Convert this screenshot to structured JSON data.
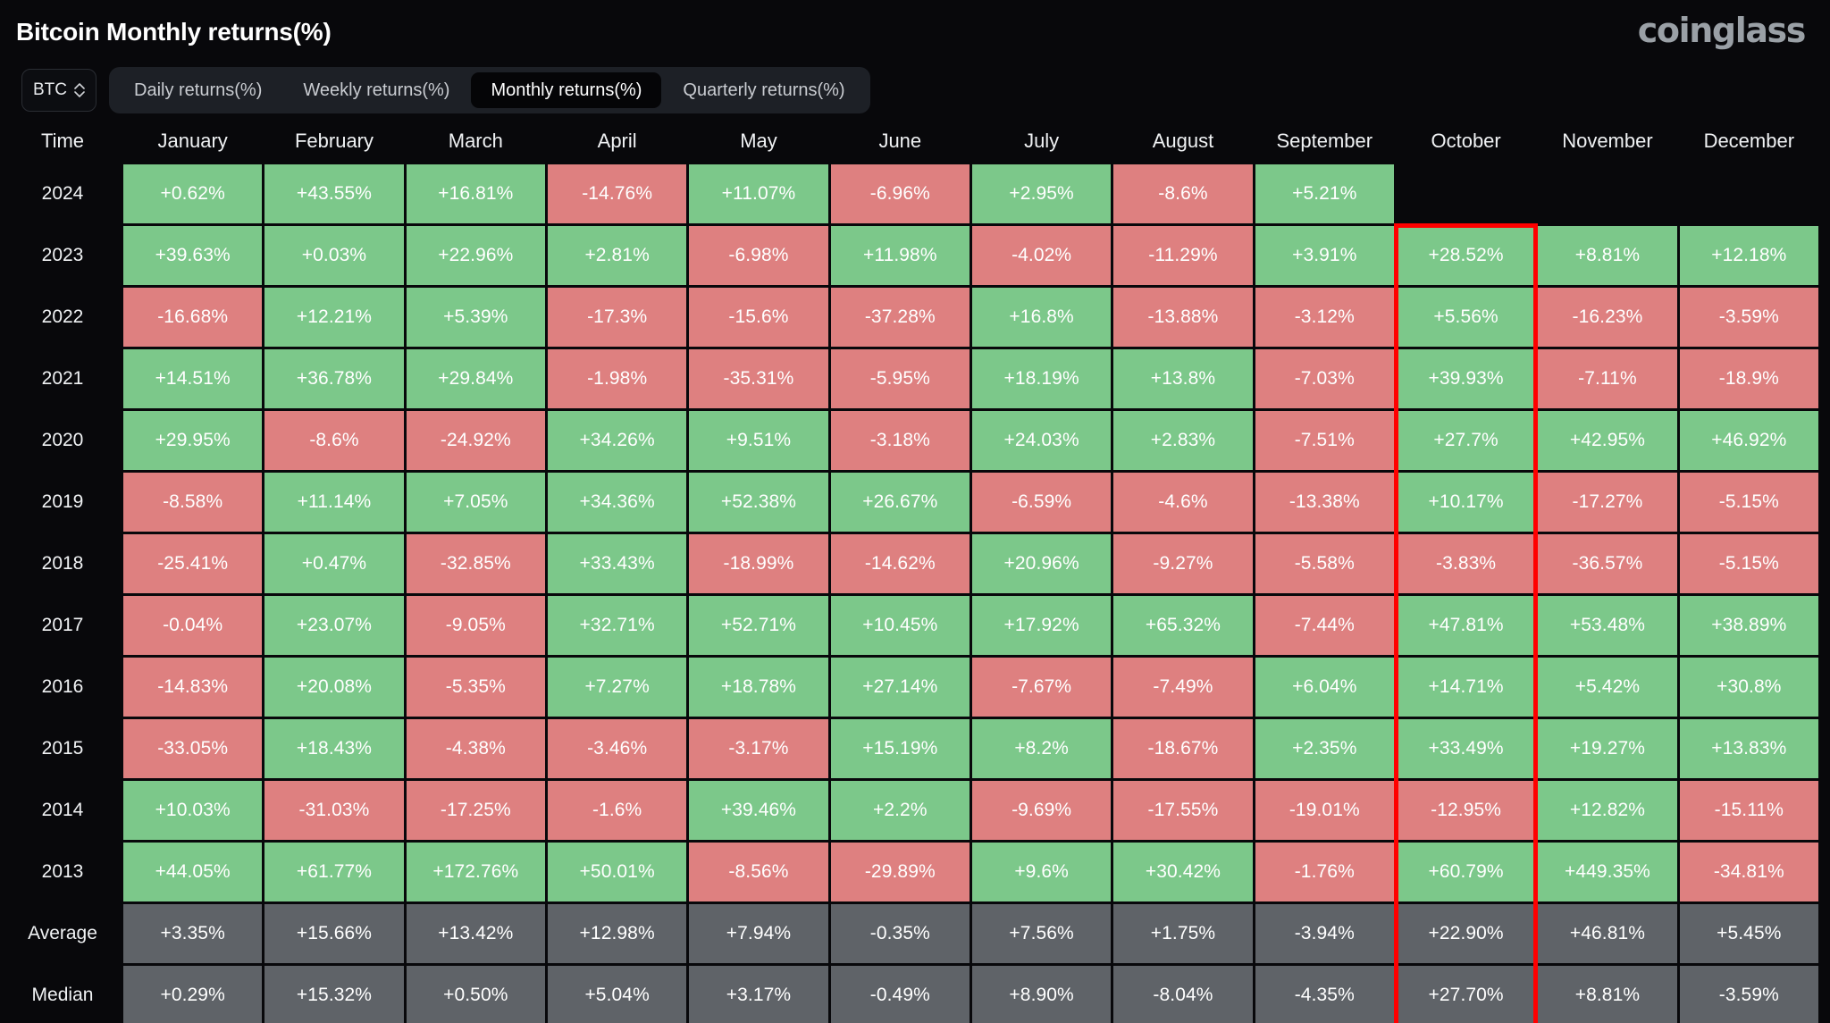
{
  "header": {
    "title": "Bitcoin Monthly returns(%)",
    "brand": "coinglass"
  },
  "controls": {
    "symbol": {
      "value": "BTC",
      "icon": "chevron-updown-icon"
    },
    "tabs": [
      {
        "label": "Daily returns(%)",
        "active": false
      },
      {
        "label": "Weekly returns(%)",
        "active": false
      },
      {
        "label": "Monthly returns(%)",
        "active": true
      },
      {
        "label": "Quarterly returns(%)",
        "active": false
      }
    ]
  },
  "highlight": {
    "color": "#ff0000",
    "column": "October",
    "from_row": "2023",
    "to_row": "Median"
  },
  "colors": {
    "positive": "#7cc88a",
    "negative": "#de8080",
    "neutral": "#5f6368",
    "background": "#08080b",
    "accent": "#ff0000"
  },
  "chart_data": {
    "type": "heatmap",
    "title": "Bitcoin Monthly returns(%)",
    "xlabel": "",
    "ylabel": "Time",
    "columns": [
      "Time",
      "January",
      "February",
      "March",
      "April",
      "May",
      "June",
      "July",
      "August",
      "September",
      "October",
      "November",
      "December"
    ],
    "rows": [
      {
        "label": "2024",
        "kind": "year",
        "values": [
          "+0.62%",
          "+43.55%",
          "+16.81%",
          "-14.76%",
          "+11.07%",
          "-6.96%",
          "+2.95%",
          "-8.6%",
          "+5.21%",
          "",
          "",
          ""
        ]
      },
      {
        "label": "2023",
        "kind": "year",
        "values": [
          "+39.63%",
          "+0.03%",
          "+22.96%",
          "+2.81%",
          "-6.98%",
          "+11.98%",
          "-4.02%",
          "-11.29%",
          "+3.91%",
          "+28.52%",
          "+8.81%",
          "+12.18%"
        ]
      },
      {
        "label": "2022",
        "kind": "year",
        "values": [
          "-16.68%",
          "+12.21%",
          "+5.39%",
          "-17.3%",
          "-15.6%",
          "-37.28%",
          "+16.8%",
          "-13.88%",
          "-3.12%",
          "+5.56%",
          "-16.23%",
          "-3.59%"
        ]
      },
      {
        "label": "2021",
        "kind": "year",
        "values": [
          "+14.51%",
          "+36.78%",
          "+29.84%",
          "-1.98%",
          "-35.31%",
          "-5.95%",
          "+18.19%",
          "+13.8%",
          "-7.03%",
          "+39.93%",
          "-7.11%",
          "-18.9%"
        ]
      },
      {
        "label": "2020",
        "kind": "year",
        "values": [
          "+29.95%",
          "-8.6%",
          "-24.92%",
          "+34.26%",
          "+9.51%",
          "-3.18%",
          "+24.03%",
          "+2.83%",
          "-7.51%",
          "+27.7%",
          "+42.95%",
          "+46.92%"
        ]
      },
      {
        "label": "2019",
        "kind": "year",
        "values": [
          "-8.58%",
          "+11.14%",
          "+7.05%",
          "+34.36%",
          "+52.38%",
          "+26.67%",
          "-6.59%",
          "-4.6%",
          "-13.38%",
          "+10.17%",
          "-17.27%",
          "-5.15%"
        ]
      },
      {
        "label": "2018",
        "kind": "year",
        "values": [
          "-25.41%",
          "+0.47%",
          "-32.85%",
          "+33.43%",
          "-18.99%",
          "-14.62%",
          "+20.96%",
          "-9.27%",
          "-5.58%",
          "-3.83%",
          "-36.57%",
          "-5.15%"
        ]
      },
      {
        "label": "2017",
        "kind": "year",
        "values": [
          "-0.04%",
          "+23.07%",
          "-9.05%",
          "+32.71%",
          "+52.71%",
          "+10.45%",
          "+17.92%",
          "+65.32%",
          "-7.44%",
          "+47.81%",
          "+53.48%",
          "+38.89%"
        ]
      },
      {
        "label": "2016",
        "kind": "year",
        "values": [
          "-14.83%",
          "+20.08%",
          "-5.35%",
          "+7.27%",
          "+18.78%",
          "+27.14%",
          "-7.67%",
          "-7.49%",
          "+6.04%",
          "+14.71%",
          "+5.42%",
          "+30.8%"
        ]
      },
      {
        "label": "2015",
        "kind": "year",
        "values": [
          "-33.05%",
          "+18.43%",
          "-4.38%",
          "-3.46%",
          "-3.17%",
          "+15.19%",
          "+8.2%",
          "-18.67%",
          "+2.35%",
          "+33.49%",
          "+19.27%",
          "+13.83%"
        ]
      },
      {
        "label": "2014",
        "kind": "year",
        "values": [
          "+10.03%",
          "-31.03%",
          "-17.25%",
          "-1.6%",
          "+39.46%",
          "+2.2%",
          "-9.69%",
          "-17.55%",
          "-19.01%",
          "-12.95%",
          "+12.82%",
          "-15.11%"
        ]
      },
      {
        "label": "2013",
        "kind": "year",
        "values": [
          "+44.05%",
          "+61.77%",
          "+172.76%",
          "+50.01%",
          "-8.56%",
          "-29.89%",
          "+9.6%",
          "+30.42%",
          "-1.76%",
          "+60.79%",
          "+449.35%",
          "-34.81%"
        ]
      },
      {
        "label": "Average",
        "kind": "summary",
        "values": [
          "+3.35%",
          "+15.66%",
          "+13.42%",
          "+12.98%",
          "+7.94%",
          "-0.35%",
          "+7.56%",
          "+1.75%",
          "-3.94%",
          "+22.90%",
          "+46.81%",
          "+5.45%"
        ]
      },
      {
        "label": "Median",
        "kind": "summary",
        "values": [
          "+0.29%",
          "+15.32%",
          "+0.50%",
          "+5.04%",
          "+3.17%",
          "-0.49%",
          "+8.90%",
          "-8.04%",
          "-4.35%",
          "+27.70%",
          "+8.81%",
          "-3.59%"
        ]
      }
    ]
  }
}
